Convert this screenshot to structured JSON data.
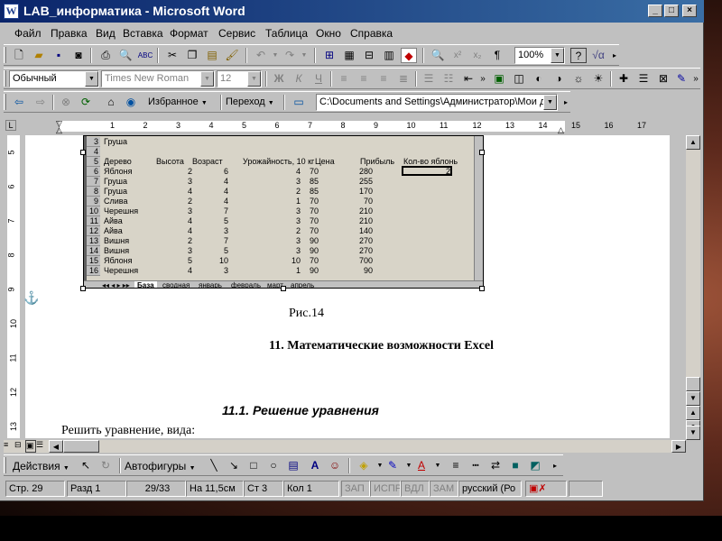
{
  "window": {
    "title": "LAB_информатика - Microsoft Word",
    "app_icon": "W",
    "buttons": [
      "_",
      "□",
      "×"
    ]
  },
  "menu": [
    "Файл",
    "Правка",
    "Вид",
    "Вставка",
    "Формат",
    "Сервис",
    "Таблица",
    "Окно",
    "Справка"
  ],
  "standard_toolbar": {
    "zoom": "100%"
  },
  "formatting_toolbar": {
    "style": "Обычный",
    "font": "Times New Roman",
    "size": "12",
    "bold": "Ж",
    "italic": "К",
    "underline": "Ч"
  },
  "web_toolbar": {
    "favorites": "Избранное",
    "go": "Переход",
    "address": "C:\\Documents and Settings\\Администратор\\Мои д"
  },
  "ruler": {
    "h_numbers": [
      "1",
      "2",
      "3",
      "4",
      "5",
      "6",
      "7",
      "8",
      "9",
      "10",
      "11",
      "12",
      "13",
      "14",
      "15",
      "16",
      "17"
    ],
    "v_numbers": [
      "5",
      "6",
      "7",
      "8",
      "9",
      "10",
      "11",
      "12",
      "13"
    ]
  },
  "spreadsheet": {
    "rows": [
      {
        "n": "3",
        "cells": [
          "Груша",
          "",
          "",
          "",
          "",
          "",
          ""
        ]
      },
      {
        "n": "4",
        "cells": [
          "",
          "",
          "",
          "",
          "",
          "",
          ""
        ]
      },
      {
        "n": "5",
        "cells": [
          "Дерево",
          "Высота",
          "Возраст",
          "Урожайность, 10 кг",
          "Цена",
          "Прибыль",
          "Кол-во яблонь"
        ]
      },
      {
        "n": "6",
        "cells": [
          "Яблоня",
          "2",
          "6",
          "4",
          "70",
          "280",
          "2"
        ]
      },
      {
        "n": "7",
        "cells": [
          "Груша",
          "3",
          "4",
          "3",
          "85",
          "255",
          ""
        ]
      },
      {
        "n": "8",
        "cells": [
          "Груша",
          "4",
          "4",
          "2",
          "85",
          "170",
          ""
        ]
      },
      {
        "n": "9",
        "cells": [
          "Слива",
          "2",
          "4",
          "1",
          "70",
          "70",
          ""
        ]
      },
      {
        "n": "10",
        "cells": [
          "Черешня",
          "3",
          "7",
          "3",
          "70",
          "210",
          ""
        ]
      },
      {
        "n": "11",
        "cells": [
          "Айва",
          "4",
          "5",
          "3",
          "70",
          "210",
          ""
        ]
      },
      {
        "n": "12",
        "cells": [
          "Айва",
          "4",
          "3",
          "2",
          "70",
          "140",
          ""
        ]
      },
      {
        "n": "13",
        "cells": [
          "Вишня",
          "2",
          "7",
          "3",
          "90",
          "270",
          ""
        ]
      },
      {
        "n": "14",
        "cells": [
          "Вишня",
          "3",
          "5",
          "3",
          "90",
          "270",
          ""
        ]
      },
      {
        "n": "15",
        "cells": [
          "Яблоня",
          "5",
          "10",
          "10",
          "70",
          "700",
          ""
        ]
      },
      {
        "n": "16",
        "cells": [
          "Черешня",
          "4",
          "3",
          "1",
          "90",
          "90",
          ""
        ]
      }
    ],
    "tabs": [
      "База",
      "сводная",
      "январь",
      "февраль",
      "март",
      "апрель"
    ]
  },
  "document": {
    "caption": "Рис.14",
    "heading": "11. Математические возможности Excel",
    "subheading": "11.1. Решение уравнения",
    "body": "Решить уравнение, вида:"
  },
  "drawing_toolbar": {
    "actions": "Действия",
    "autoshapes": "Автофигуры"
  },
  "statusbar": {
    "page": "Стр. 29",
    "section": "Разд 1",
    "pages": "29/33",
    "at": "На 11,5см",
    "line": "Ст 3",
    "col": "Кол 1",
    "rec": "ЗАП",
    "trk": "ИСПР",
    "ext": "ВДЛ",
    "ovr": "ЗАМ",
    "lang": "русский (Ро"
  }
}
